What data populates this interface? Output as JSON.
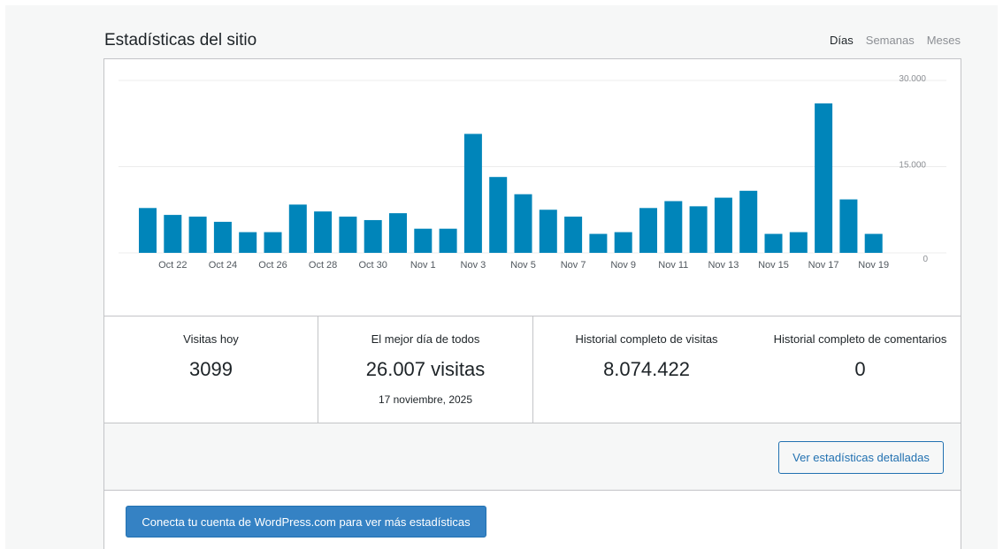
{
  "header": {
    "title": "Estadísticas del sitio",
    "tabs": [
      {
        "label": "Días",
        "active": true
      },
      {
        "label": "Semanas",
        "active": false
      },
      {
        "label": "Meses",
        "active": false
      }
    ]
  },
  "chart_data": {
    "type": "bar",
    "categories": [
      "Oct 21",
      "Oct 22",
      "Oct 23",
      "Oct 24",
      "Oct 25",
      "Oct 26",
      "Oct 27",
      "Oct 28",
      "Oct 29",
      "Oct 30",
      "Oct 31",
      "Nov 1",
      "Nov 2",
      "Nov 3",
      "Nov 4",
      "Nov 5",
      "Nov 6",
      "Nov 7",
      "Nov 8",
      "Nov 9",
      "Nov 10",
      "Nov 11",
      "Nov 12",
      "Nov 13",
      "Nov 14",
      "Nov 15",
      "Nov 16",
      "Nov 17",
      "Nov 18",
      "Nov 19"
    ],
    "values": [
      7800,
      6600,
      6300,
      5400,
      3600,
      3600,
      8400,
      7200,
      6300,
      5700,
      6900,
      4200,
      4200,
      20700,
      13200,
      10200,
      7500,
      6300,
      3300,
      3600,
      7800,
      9000,
      8100,
      9600,
      10800,
      3300,
      3600,
      26007,
      9300,
      3300
    ],
    "x_tick_labels": [
      "Oct 22",
      "Oct 24",
      "Oct 26",
      "Oct 28",
      "Oct 30",
      "Nov 1",
      "Nov 3",
      "Nov 5",
      "Nov 7",
      "Nov 9",
      "Nov 11",
      "Nov 13",
      "Nov 15",
      "Nov 17",
      "Nov 19"
    ],
    "y_tick_labels": [
      "0",
      "15.000",
      "30.000"
    ],
    "y_ticks": [
      0,
      15000,
      30000
    ],
    "ylim": [
      0,
      30000
    ],
    "bar_color": "#0085ba",
    "grid": true,
    "title": "",
    "xlabel": "",
    "ylabel": ""
  },
  "stats": {
    "today": {
      "label": "Visitas hoy",
      "value": "3099"
    },
    "best_day": {
      "label": "El mejor día de todos",
      "value": "26.007 visitas",
      "date": "17 noviembre, 2025"
    },
    "all_time_views": {
      "label": "Historial completo de visitas",
      "value": "8.074.422"
    },
    "all_time_comments": {
      "label": "Historial completo de comentarios",
      "value": "0"
    }
  },
  "actions": {
    "detailed_stats_label": "Ver estadísticas detalladas",
    "connect_label": "Conecta tu cuenta de WordPress.com para ver más estadísticas"
  },
  "colors": {
    "accent": "#2271b1",
    "bar": "#0085ba",
    "connect_button_bg": "#3582c4"
  }
}
